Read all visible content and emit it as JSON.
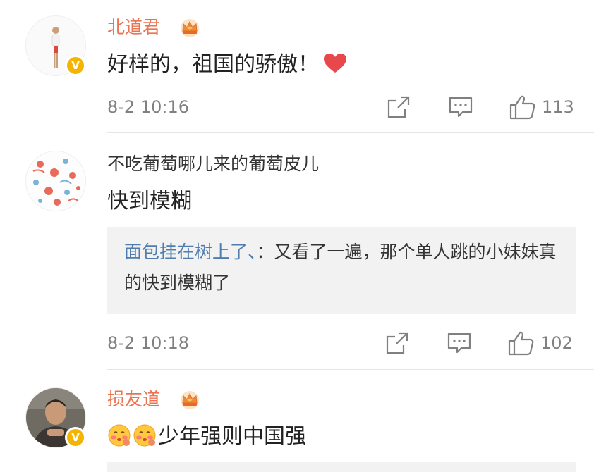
{
  "comments": [
    {
      "username": "北道君",
      "text": "好样的，祖国的骄傲！",
      "time": "8-2 10:16",
      "likes": "113",
      "verified_badge": "V",
      "vip_crown": true,
      "avatar": "standing-figure-avatar",
      "text_emoji": "heart-icon"
    },
    {
      "username": "不吃葡萄哪儿来的葡萄皮儿",
      "text": "快到模糊",
      "reply": {
        "user": "面包挂在树上了、",
        "separator": "：",
        "text": "又看了一遍，那个单人跳的小妹妹真的快到模糊了"
      },
      "time": "8-2 10:18",
      "likes": "102",
      "avatar": "pattern-avatar"
    },
    {
      "username": "损友道",
      "text": "少年强则中国强",
      "verified_badge": "V",
      "vip_crown": true,
      "avatar": "man-photo-avatar",
      "text_emoji": "blushing-face-emoji"
    }
  ],
  "colors": {
    "vip_name": "#eb7350",
    "reply_user": "#507daf",
    "meta_gray": "#808080",
    "reply_bg": "#f2f2f2",
    "badge": "#f5b400",
    "heart": "#e8474c"
  },
  "icons": [
    "share-icon",
    "comment-icon",
    "like-icon",
    "crown-icon",
    "heart-icon"
  ]
}
